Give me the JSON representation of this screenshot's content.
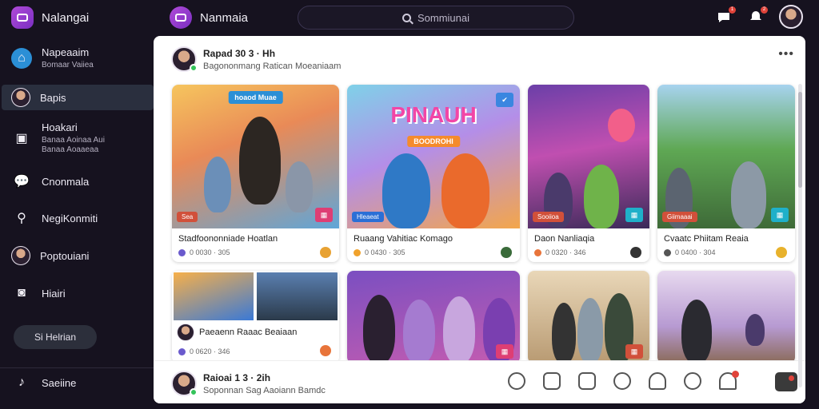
{
  "topbar": {
    "app_name": "Nalangai",
    "app2_name": "Nanmaia",
    "search_placeholder": "Sommiunai",
    "notif_count_1": "1",
    "notif_count_2": "2"
  },
  "sidebar": {
    "items": [
      {
        "label": "Napeaaim",
        "sub": "Bomaar Vaiiea"
      },
      {
        "label": "Bapis"
      },
      {
        "label": "Hoakari",
        "sub": "Banaa Aoinaa Aui",
        "sub2": "Banaa Aoaaeaa"
      },
      {
        "label": "Cnonmala"
      },
      {
        "label": "NegiKonmiti"
      },
      {
        "label": "Poptouiani"
      },
      {
        "label": "Hiairi"
      },
      {
        "label": "Saeiine"
      }
    ],
    "pill_label": "Si Helrian"
  },
  "post": {
    "author": "Rapad 30  3 · Hh",
    "meta": "Bagononmang Ratican Moeaniaam",
    "more": "•••"
  },
  "cards": [
    {
      "overlay": "hoaod Muae",
      "title": "Stadfoononniade Hoatlan",
      "stats": "0 0030 · 305",
      "badge": "Sea"
    },
    {
      "overlay": "PINAUH",
      "subtitle": "BOODROHI",
      "title": "Ruaang Vahitiac Komago",
      "stats": "0 0430 · 305",
      "badge": "Hleaeat"
    },
    {
      "title": "Daon Nanliaqia",
      "stats": "0 0320 · 346",
      "badge": "Sooiioa"
    },
    {
      "title": "Cvaatc Phiitam Reaia",
      "stats": "0 0400 · 304",
      "badge": "Giimaaai"
    },
    {
      "title": "Paeaenn Raaac Beaiaan",
      "stats": "0 0620 · 346"
    }
  ],
  "bottom_post": {
    "author": "Raioai  1 3 · 2ih",
    "meta": "Soponnan Sag Aaoiann Bamdc"
  },
  "colors": {
    "accent": "#b04ad8",
    "sidebar_bg": "#16121f",
    "active_bg": "#2a2f3e",
    "notify": "#e0433a",
    "online": "#34c35a"
  },
  "icons": [
    "messages-icon",
    "bell-icon",
    "heart-icon",
    "share-icon",
    "comment-icon",
    "emoji-icon",
    "save-icon",
    "search-icon",
    "profile-icon"
  ]
}
